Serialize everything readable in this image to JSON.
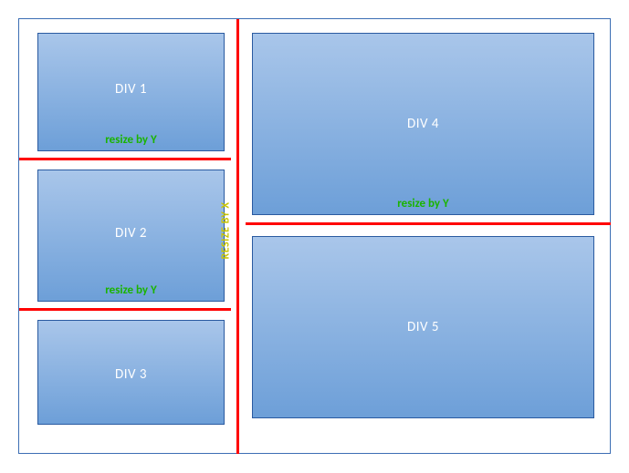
{
  "boxes": {
    "div1": {
      "label": "DIV 1",
      "resize": "resize by Y"
    },
    "div2": {
      "label": "DIV 2",
      "resize": "resize by Y"
    },
    "div3": {
      "label": "DIV 3"
    },
    "div4": {
      "label": "DIV 4",
      "resize": "resize by Y"
    },
    "div5": {
      "label": "DIV 5"
    }
  },
  "resize_x": "RESIZE BY X"
}
